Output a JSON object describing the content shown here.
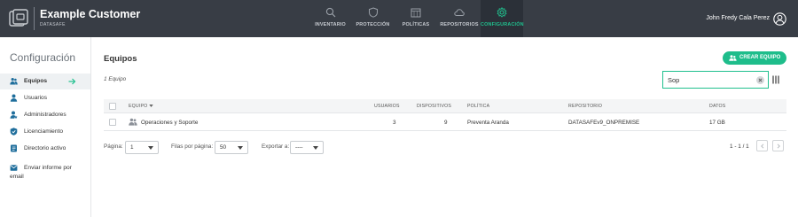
{
  "header": {
    "app_title": "Example Customer",
    "app_subtitle": "DATASAFE",
    "user_name": "John Fredy Cala Perez",
    "nav": [
      {
        "label": "INVENTARIO",
        "icon": "search-icon"
      },
      {
        "label": "PROTECCIÓN",
        "icon": "shield-icon"
      },
      {
        "label": "POLÍTICAS",
        "icon": "calendar-icon"
      },
      {
        "label": "REPOSITORIOS",
        "icon": "cloud-icon"
      },
      {
        "label": "CONFIGURACIÓN",
        "icon": "gear-icon",
        "active": true
      }
    ]
  },
  "sidebar": {
    "title": "Configuración",
    "items": [
      {
        "label": "Equipos",
        "icon": "team-icon",
        "active": true
      },
      {
        "label": "Usuarios",
        "icon": "user-icon"
      },
      {
        "label": "Administradores",
        "icon": "admin-icon"
      },
      {
        "label": "Licenciamiento",
        "icon": "license-icon"
      },
      {
        "label": "Directorio activo",
        "icon": "directory-icon"
      },
      {
        "label": "Enviar informe por email",
        "icon": "report-icon"
      }
    ]
  },
  "main": {
    "title": "Equipos",
    "create_button": "CREAR EQUIPO",
    "count_text": "1 Equipo",
    "search_value": "Sop"
  },
  "table": {
    "columns": [
      "EQUIPO",
      "USUARIOS",
      "DISPOSITIVOS",
      "POLÍTICA",
      "REPOSITORIO",
      "DATOS"
    ],
    "rows": [
      {
        "equipo": "Operaciones y Soporte",
        "usuarios": "3",
        "dispositivos": "9",
        "politica": "Preventa Aranda",
        "repositorio": "DATASAFEv9_ONPREMISE",
        "datos": "17 GB"
      }
    ]
  },
  "pagination": {
    "page_label": "Página:",
    "page_value": "1",
    "rows_label": "Filas por página:",
    "rows_value": "50",
    "export_label": "Exportar a:",
    "export_value": "----",
    "range_text": "1 - 1 / 1"
  },
  "colors": {
    "topbar": "#383d45",
    "accent": "#1ebd8b"
  }
}
